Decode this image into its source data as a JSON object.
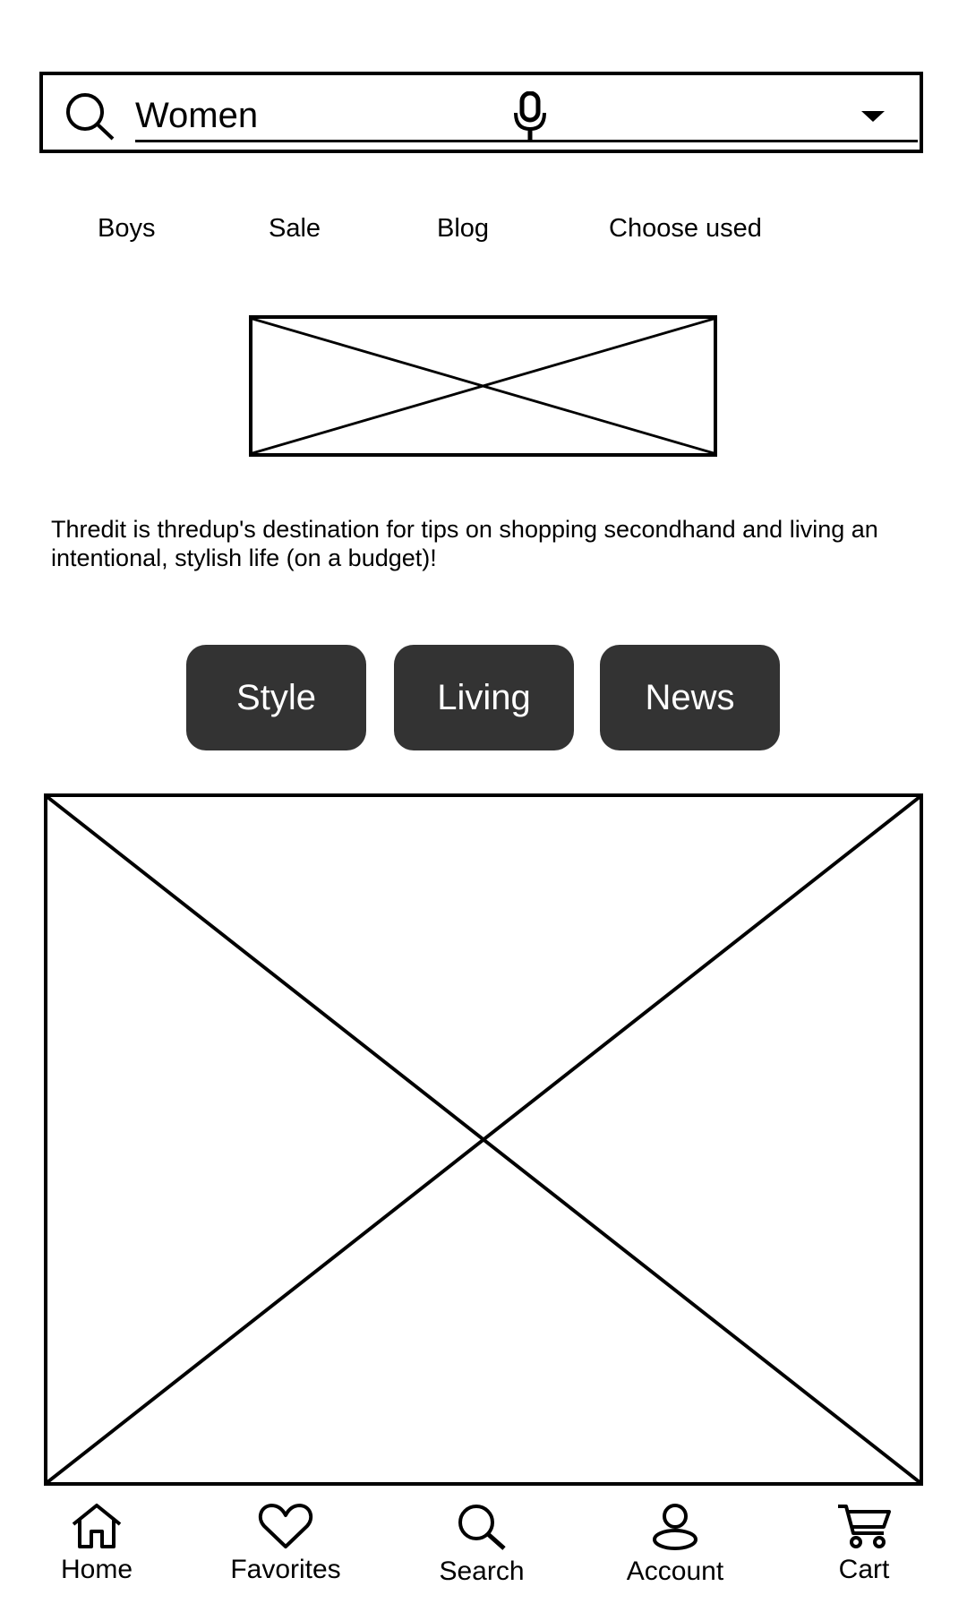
{
  "search": {
    "value": "Women",
    "icons": {
      "search": "search-icon",
      "mic": "microphone-icon",
      "dropdown": "dropdown-caret-icon"
    }
  },
  "categories": [
    "Boys",
    "Sale",
    "Blog",
    "Choose used"
  ],
  "blurb": "Thredit is thredup's destination for tips on shopping secondhand and living an intentional, stylish life (on a budget)!",
  "topics": [
    "Style",
    "Living",
    "News"
  ],
  "colors": {
    "pill_background": "#333333",
    "pill_text": "#ffffff",
    "stroke": "#000000"
  },
  "tabs": [
    {
      "label": "Home",
      "icon": "home-icon"
    },
    {
      "label": "Favorites",
      "icon": "heart-icon"
    },
    {
      "label": "Search",
      "icon": "search-icon"
    },
    {
      "label": "Account",
      "icon": "account-icon"
    },
    {
      "label": "Cart",
      "icon": "cart-icon"
    }
  ]
}
